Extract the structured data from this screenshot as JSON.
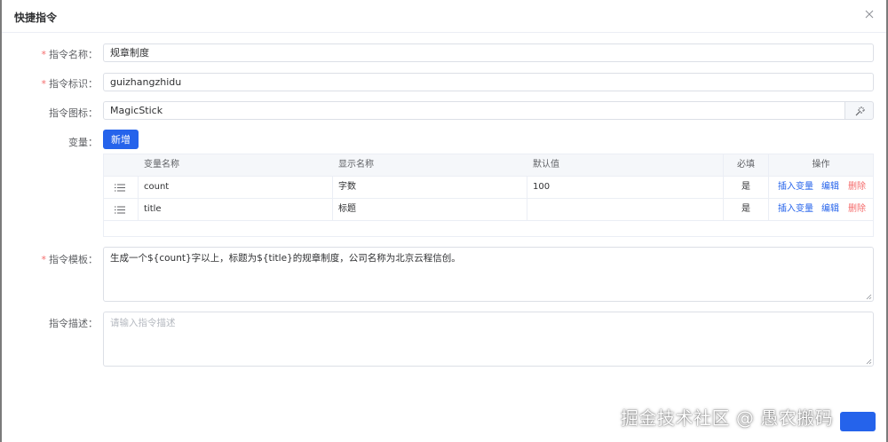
{
  "dialog": {
    "title": "快捷指令"
  },
  "form": {
    "name": {
      "label": "指令名称：",
      "value": "规章制度"
    },
    "key": {
      "label": "指令标识：",
      "value": "guizhangzhidu"
    },
    "icon": {
      "label": "指令图标：",
      "value": "MagicStick",
      "icon": "magic-stick-icon"
    },
    "variables": {
      "label": "变量：",
      "add_label": "新增",
      "columns": [
        "变量名称",
        "显示名称",
        "默认值",
        "必填",
        "操作"
      ],
      "rows": [
        {
          "name": "count",
          "display": "字数",
          "default": "100",
          "required": "是"
        },
        {
          "name": "title",
          "display": "标题",
          "default": "",
          "required": "是"
        }
      ],
      "ops": {
        "insert": "插入变量",
        "edit": "编辑",
        "delete": "删除"
      }
    },
    "template": {
      "label": "指令模板：",
      "value": "生成一个${count}字以上，标题为${title}的规章制度，公司名称为北京云程信创。"
    },
    "description": {
      "label": "指令描述：",
      "placeholder": "请输入指令描述"
    }
  },
  "watermark": "掘金技术社区 @ 愚农搬码",
  "colors": {
    "primary": "#2563eb",
    "danger": "#f56c6c",
    "required": "#f56c6c"
  }
}
